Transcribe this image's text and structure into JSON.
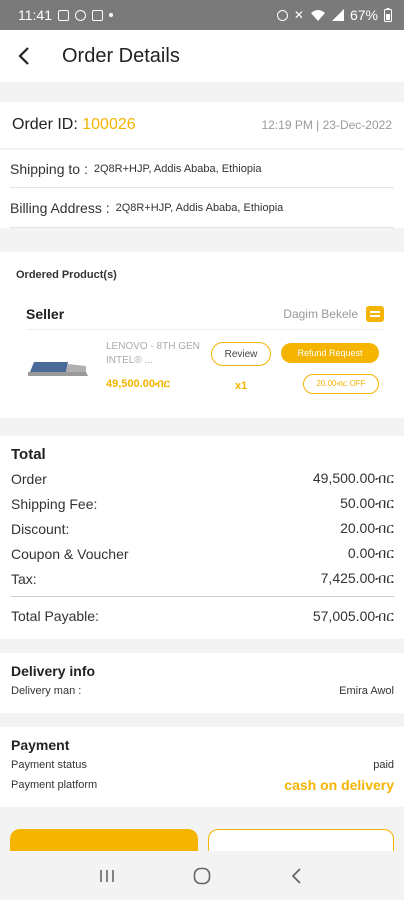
{
  "status_bar": {
    "time": "11:41",
    "battery": "67%"
  },
  "header": {
    "title": "Order Details"
  },
  "order": {
    "id_label": "Order ID:",
    "id": "100026",
    "datetime": "12:19 PM | 23-Dec-2022",
    "shipping_label": "Shipping to :",
    "shipping_value": "2Q8R+HJP, Addis Ababa, Ethiopia",
    "billing_label": "Billing Address :",
    "billing_value": "2Q8R+HJP, Addis Ababa, Ethiopia"
  },
  "products": {
    "section_label": "Ordered Product(s)",
    "seller_label": "Seller",
    "seller_name": "Dagim Bekele",
    "item": {
      "name": "LENOVO - 8TH GEN INTEL® ...",
      "price": "49,500.00ብር",
      "quantity": "x1",
      "review_label": "Review",
      "refund_label": "Refund Request",
      "discount_label": "20.00ብር OFF"
    }
  },
  "totals": {
    "title": "Total",
    "rows": [
      {
        "label": "Order",
        "value": "49,500.00ብር"
      },
      {
        "label": "Shipping Fee:",
        "value": "50.00ብር"
      },
      {
        "label": "Discount:",
        "value": "20.00ብር"
      },
      {
        "label": "Coupon & Voucher",
        "value": "0.00ብር"
      },
      {
        "label": "Tax:",
        "value": "7,425.00ብር"
      }
    ],
    "payable_label": "Total Payable:",
    "payable_value": "57,005.00ብር"
  },
  "delivery": {
    "title": "Delivery info",
    "man_label": "Delivery man :",
    "man_value": "Emira Awol"
  },
  "payment": {
    "title": "Payment",
    "status_label": "Payment status",
    "status_value": "paid",
    "platform_label": "Payment platform",
    "platform_value": "cash on delivery"
  },
  "colors": {
    "accent": "#f4b400",
    "status_bar": "#7a7a7a"
  }
}
